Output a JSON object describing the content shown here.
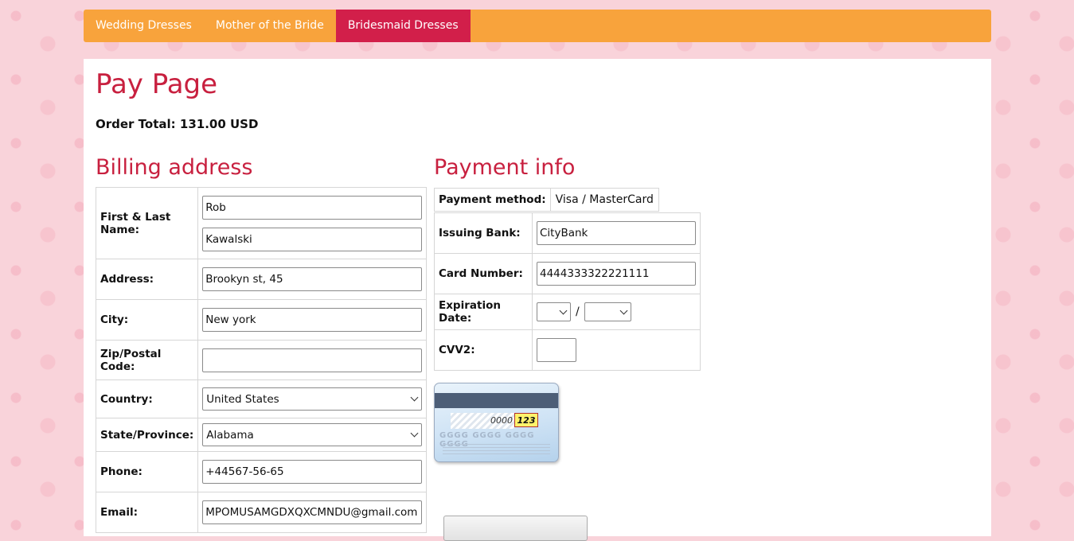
{
  "nav": {
    "items": [
      {
        "label": "Wedding Dresses",
        "active": false
      },
      {
        "label": "Mother of the Bride",
        "active": false
      },
      {
        "label": "Bridesmaid Dresses",
        "active": true
      }
    ]
  },
  "page": {
    "title": "Pay Page",
    "order_total": "Order Total: 131.00 USD"
  },
  "billing": {
    "heading": "Billing address",
    "name_label": "First & Last Name:",
    "first_name": "Rob",
    "last_name": "Kawalski",
    "address_label": "Address:",
    "address": "Brookyn st, 45",
    "city_label": "City:",
    "city": "New york",
    "zip_label": "Zip/Postal Code:",
    "zip": "",
    "country_label": "Country:",
    "country": "United States",
    "state_label": "State/Province:",
    "state": "Alabama",
    "phone_label": "Phone:",
    "phone": "+44567-56-65",
    "email_label": "Email:",
    "email": "MPOMUSAMGDXQXCMNDU@gmail.com"
  },
  "payment": {
    "heading": "Payment info",
    "method_label": "Payment method:",
    "method": "Visa / MasterCard",
    "bank_label": "Issuing Bank:",
    "bank": "CityBank",
    "card_number_label": "Card Number:",
    "card_number": "4444333322221111",
    "expiration_label": "Expiration Date:",
    "exp_month": "",
    "exp_separator": "/",
    "exp_year": "",
    "cvv_label": "CVV2:",
    "cvv": ""
  },
  "card_image": {
    "number_hint": "0000",
    "cvv_hint": "123",
    "digits_hint": "GGGG GGGG GGGG GGGG"
  },
  "colors": {
    "nav_bg": "#f8a33c",
    "nav_active": "#d21f4a",
    "heading": "#c8203f",
    "page_bg": "#f9d3da"
  }
}
